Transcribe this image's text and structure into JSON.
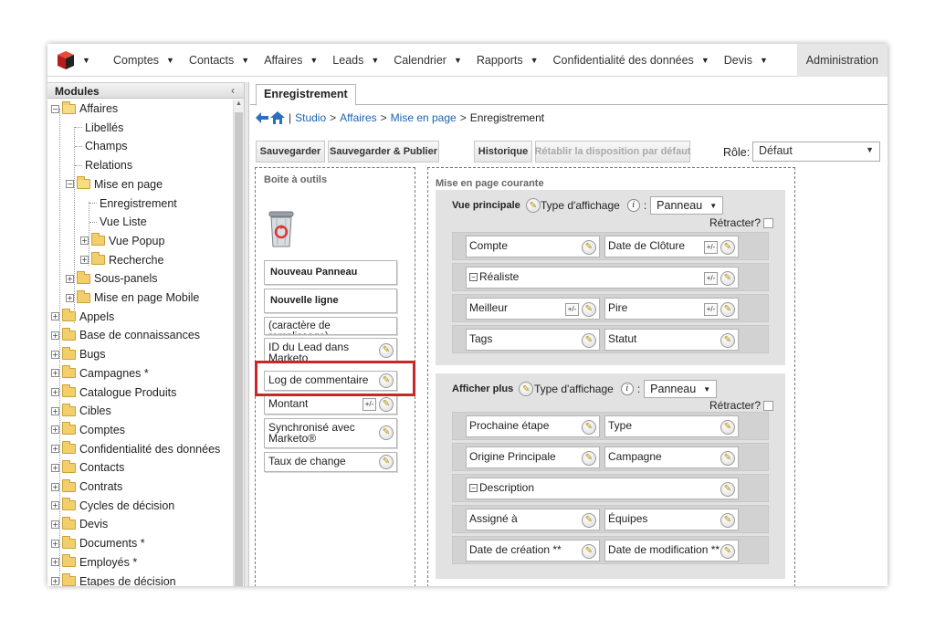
{
  "nav": {
    "items": [
      "Comptes",
      "Contacts",
      "Affaires",
      "Leads",
      "Calendrier",
      "Rapports",
      "Confidentialité des données",
      "Devis"
    ],
    "active": "Administration"
  },
  "modules": {
    "title": "Modules",
    "collapse": "‹",
    "tree": [
      {
        "label": "Affaires"
      },
      {
        "label": "Libellés"
      },
      {
        "label": "Champs"
      },
      {
        "label": "Relations"
      },
      {
        "label": "Mise en page"
      },
      {
        "label": "Enregistrement"
      },
      {
        "label": "Vue Liste"
      },
      {
        "label": "Vue Popup"
      },
      {
        "label": "Recherche"
      },
      {
        "label": "Sous-panels"
      },
      {
        "label": "Mise en page Mobile"
      },
      {
        "label": "Appels"
      },
      {
        "label": "Base de connaissances"
      },
      {
        "label": "Bugs"
      },
      {
        "label": "Campagnes *"
      },
      {
        "label": "Catalogue Produits"
      },
      {
        "label": "Cibles"
      },
      {
        "label": "Comptes"
      },
      {
        "label": "Confidentialité des données"
      },
      {
        "label": "Contacts"
      },
      {
        "label": "Contrats"
      },
      {
        "label": "Cycles de décision"
      },
      {
        "label": "Devis"
      },
      {
        "label": "Documents *"
      },
      {
        "label": "Employés *"
      },
      {
        "label": "Etapes de décision"
      }
    ]
  },
  "tab": "Enregistrement",
  "breadcrumb": {
    "studio": "Studio",
    "affaires": "Affaires",
    "mise_en_page": "Mise en page",
    "current": "Enregistrement",
    "sep": ">",
    "bar": "|"
  },
  "toolbar": {
    "save": "Sauvegarder",
    "save_publish": "Sauvegarder & Publier",
    "history": "Historique",
    "restore": "Rétablir la disposition par défaut",
    "role_label": "Rôle:",
    "role_value": "Défaut"
  },
  "toolbox": {
    "title": "Boite à outils",
    "new_panel": "Nouveau Panneau",
    "new_row": "Nouvelle ligne",
    "filler": "(caractère de remplissage)",
    "fields": [
      "ID du Lead dans Marketo",
      "Log de commentaire",
      "Montant",
      "Synchronisé avec Marketo®",
      "Taux de change"
    ]
  },
  "layout": {
    "title": "Mise en page courante",
    "panel1": {
      "name": "Vue principale",
      "type_label": "Type d'affichage",
      "colon": ":",
      "type_value": "Panneau",
      "retract": "Rétracter?",
      "rows": [
        [
          "Compte",
          "Date de Clôture"
        ],
        [
          "Réaliste"
        ],
        [
          "Meilleur",
          "Pire"
        ],
        [
          "Tags",
          "Statut"
        ]
      ]
    },
    "panel2": {
      "name": "Afficher plus",
      "type_label": "Type d'affichage",
      "colon": ":",
      "type_value": "Panneau",
      "retract": "Rétracter?",
      "rows": [
        [
          "Prochaine étape",
          "Type"
        ],
        [
          "Origine Principale",
          "Campagne"
        ],
        [
          "Description"
        ],
        [
          "Assigné à",
          "Équipes"
        ],
        [
          "Date de création **",
          "Date de modification **"
        ]
      ]
    }
  },
  "colors": {
    "highlight": "#c8282a",
    "link": "#1a63b0",
    "panel_bg": "#e2e2e2"
  }
}
